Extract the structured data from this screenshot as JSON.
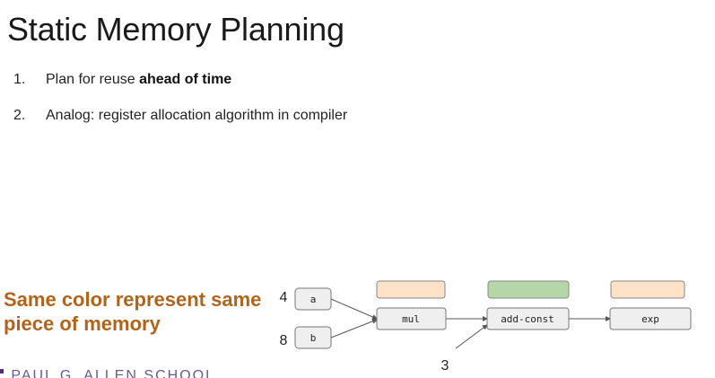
{
  "title": "Static Memory Planning",
  "list": [
    {
      "num": "1.",
      "text_before": "Plan for reuse ",
      "text_bold": "ahead of time"
    },
    {
      "num": "2.",
      "text_before": "Analog: register allocation algorithm in compiler",
      "text_bold": ""
    }
  ],
  "callout": "Same color represent  same piece of memory",
  "footer": "PAUL G. ALLEN SCHOOL",
  "colors": {
    "peach": "#fde2c8",
    "green": "#b5d7a8",
    "node_fill": "#efefef",
    "callout": "#b0641c",
    "footer_purple": "#4b2e83"
  },
  "diagram": {
    "nodes": {
      "a": "a",
      "b": "b",
      "mul": "mul",
      "add_const": "add-const",
      "exp": "exp"
    },
    "inputs": {
      "a_value": "4",
      "b_value": "8",
      "const_value": "3"
    },
    "memory_blocks": [
      {
        "over": "mul",
        "color": "peach"
      },
      {
        "over": "add-const",
        "color": "green"
      },
      {
        "over": "exp",
        "color": "peach"
      }
    ]
  }
}
